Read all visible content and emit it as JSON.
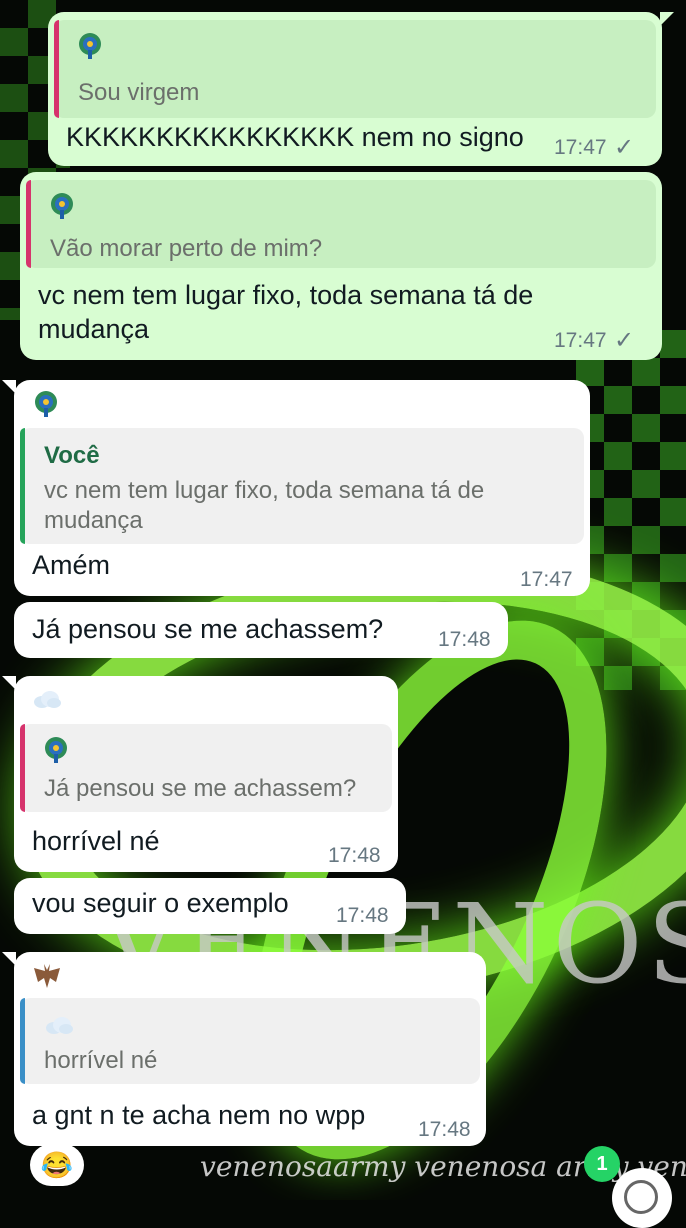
{
  "messages": {
    "m1": {
      "quote_text": "Sou virgem",
      "text": "KKKKKKKKKKKKKKKK nem no signo",
      "time": "17:47"
    },
    "m2": {
      "quote_text": "Vão morar perto de mim?",
      "text": "vc nem tem lugar fixo, toda semana tá de mudança",
      "time": "17:47"
    },
    "m3": {
      "quote_author": "Você",
      "quote_text": "vc nem tem lugar fixo, toda semana tá de mudança",
      "text": "Amém",
      "time": "17:47"
    },
    "m4": {
      "text": "Já pensou se me achassem?",
      "time": "17:48"
    },
    "m5": {
      "quote_text": "Já pensou se me achassem?",
      "text": "horrível né",
      "time": "17:48"
    },
    "m6": {
      "text": "vou seguir o exemplo",
      "time": "17:48"
    },
    "m7": {
      "quote_text": "horrível né",
      "text": "a gnt n te acha nem no wpp",
      "time": "17:48"
    }
  },
  "reaction": {
    "emoji": "😂"
  },
  "unread_badge": "1",
  "background_text": {
    "big": "VENENOSA",
    "script": "venenosaarmy venenosa army venenosaar"
  },
  "colors": {
    "outgoing": "#d8fdd2",
    "incoming": "#ffffff",
    "badge": "#25d366",
    "quote_bar_red": "#d6336c",
    "quote_bar_green": "#25a35a",
    "quote_bar_blue": "#3a8fc7"
  }
}
